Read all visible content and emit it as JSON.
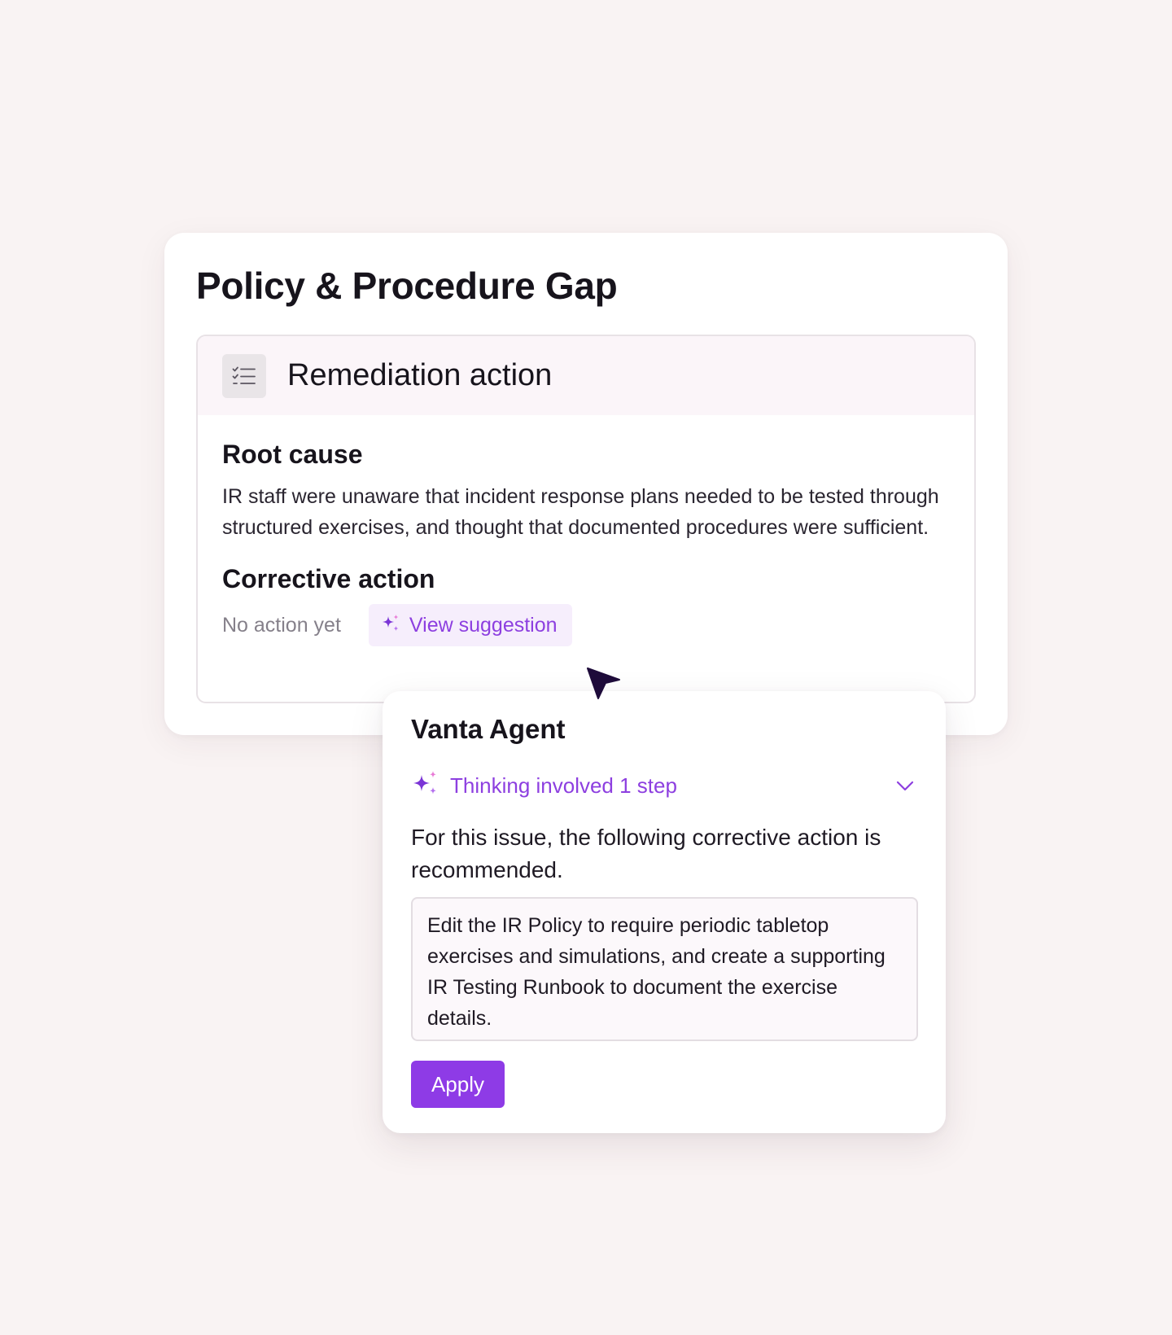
{
  "card": {
    "title": "Policy & Procedure Gap"
  },
  "remediation": {
    "icon": "checklist-icon",
    "title": "Remediation action",
    "root_cause": {
      "heading": "Root cause",
      "text": "IR staff were unaware that incident response plans needed to be tested through structured exercises, and thought that documented procedures were sufficient."
    },
    "corrective_action": {
      "heading": "Corrective action",
      "status": "No action yet",
      "suggestion_button": "View suggestion",
      "suggestion_icon": "sparkle-icon"
    }
  },
  "agent": {
    "title": "Vanta Agent",
    "thinking_label": "Thinking involved 1 step",
    "thinking_icon": "sparkle-icon",
    "expand_icon": "chevron-down-icon",
    "recommendation_intro": "For this issue, the following corrective action is recommended.",
    "suggestion_text": "Edit the IR Policy to require periodic tabletop exercises and simulations, and create a supporting IR Testing Runbook to document the exercise details.",
    "apply_label": "Apply"
  },
  "colors": {
    "background": "#f9f3f3",
    "accent": "#8e3be6",
    "accent_text": "#8d3fe0",
    "sparkle_pink": "#e87ad6",
    "cursor": "#1e0b3a"
  }
}
